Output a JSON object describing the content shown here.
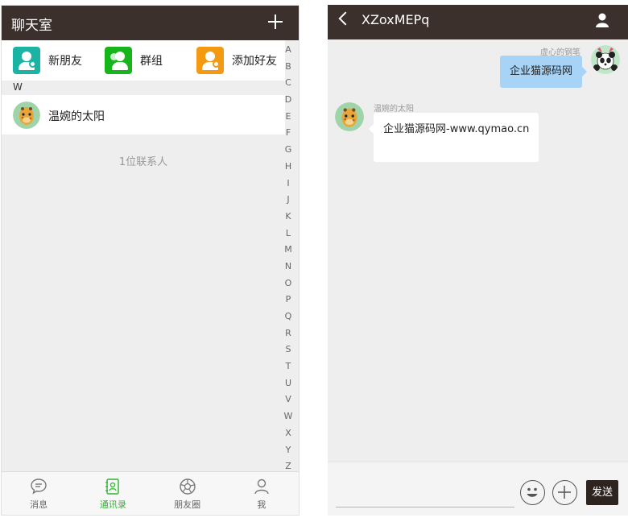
{
  "contacts_screen": {
    "title": "聊天室",
    "quick_actions": [
      {
        "label": "新朋友",
        "icon": "new-friend-icon",
        "color": "#1bb3a4"
      },
      {
        "label": "群组",
        "icon": "group-icon",
        "color": "#15b51b"
      },
      {
        "label": "添加好友",
        "icon": "add-friend-icon",
        "color": "#f39a12"
      }
    ],
    "section_letter": "W",
    "contacts": [
      {
        "name": "温婉的太阳",
        "avatar": "giraffe-avatar"
      }
    ],
    "contact_count": "1位联系人",
    "index_letters": [
      "A",
      "B",
      "C",
      "D",
      "E",
      "F",
      "G",
      "H",
      "I",
      "J",
      "K",
      "L",
      "M",
      "N",
      "O",
      "P",
      "Q",
      "R",
      "S",
      "T",
      "U",
      "V",
      "W",
      "X",
      "Y",
      "Z"
    ],
    "tabs": [
      {
        "label": "消息",
        "icon": "message-icon",
        "active": false
      },
      {
        "label": "通讯录",
        "icon": "contacts-icon",
        "active": true
      },
      {
        "label": "朋友圈",
        "icon": "moments-icon",
        "active": false
      },
      {
        "label": "我",
        "icon": "me-icon",
        "active": false
      }
    ]
  },
  "chat_screen": {
    "title": "XZoxMEPq",
    "messages": [
      {
        "from": "self",
        "sender": "虚心的钢笔",
        "text": "企业猫源码网",
        "avatar": "panda-avatar"
      },
      {
        "from": "other",
        "sender": "温婉的太阳",
        "text": "企业猫源码网-www.qymao.cn",
        "avatar": "giraffe-avatar"
      }
    ],
    "input_value": "",
    "send_label": "发送"
  },
  "colors": {
    "header_bg": "#3b302b",
    "active_tab": "#2db52d",
    "outgoing_bubble": "#a7d3f7"
  }
}
